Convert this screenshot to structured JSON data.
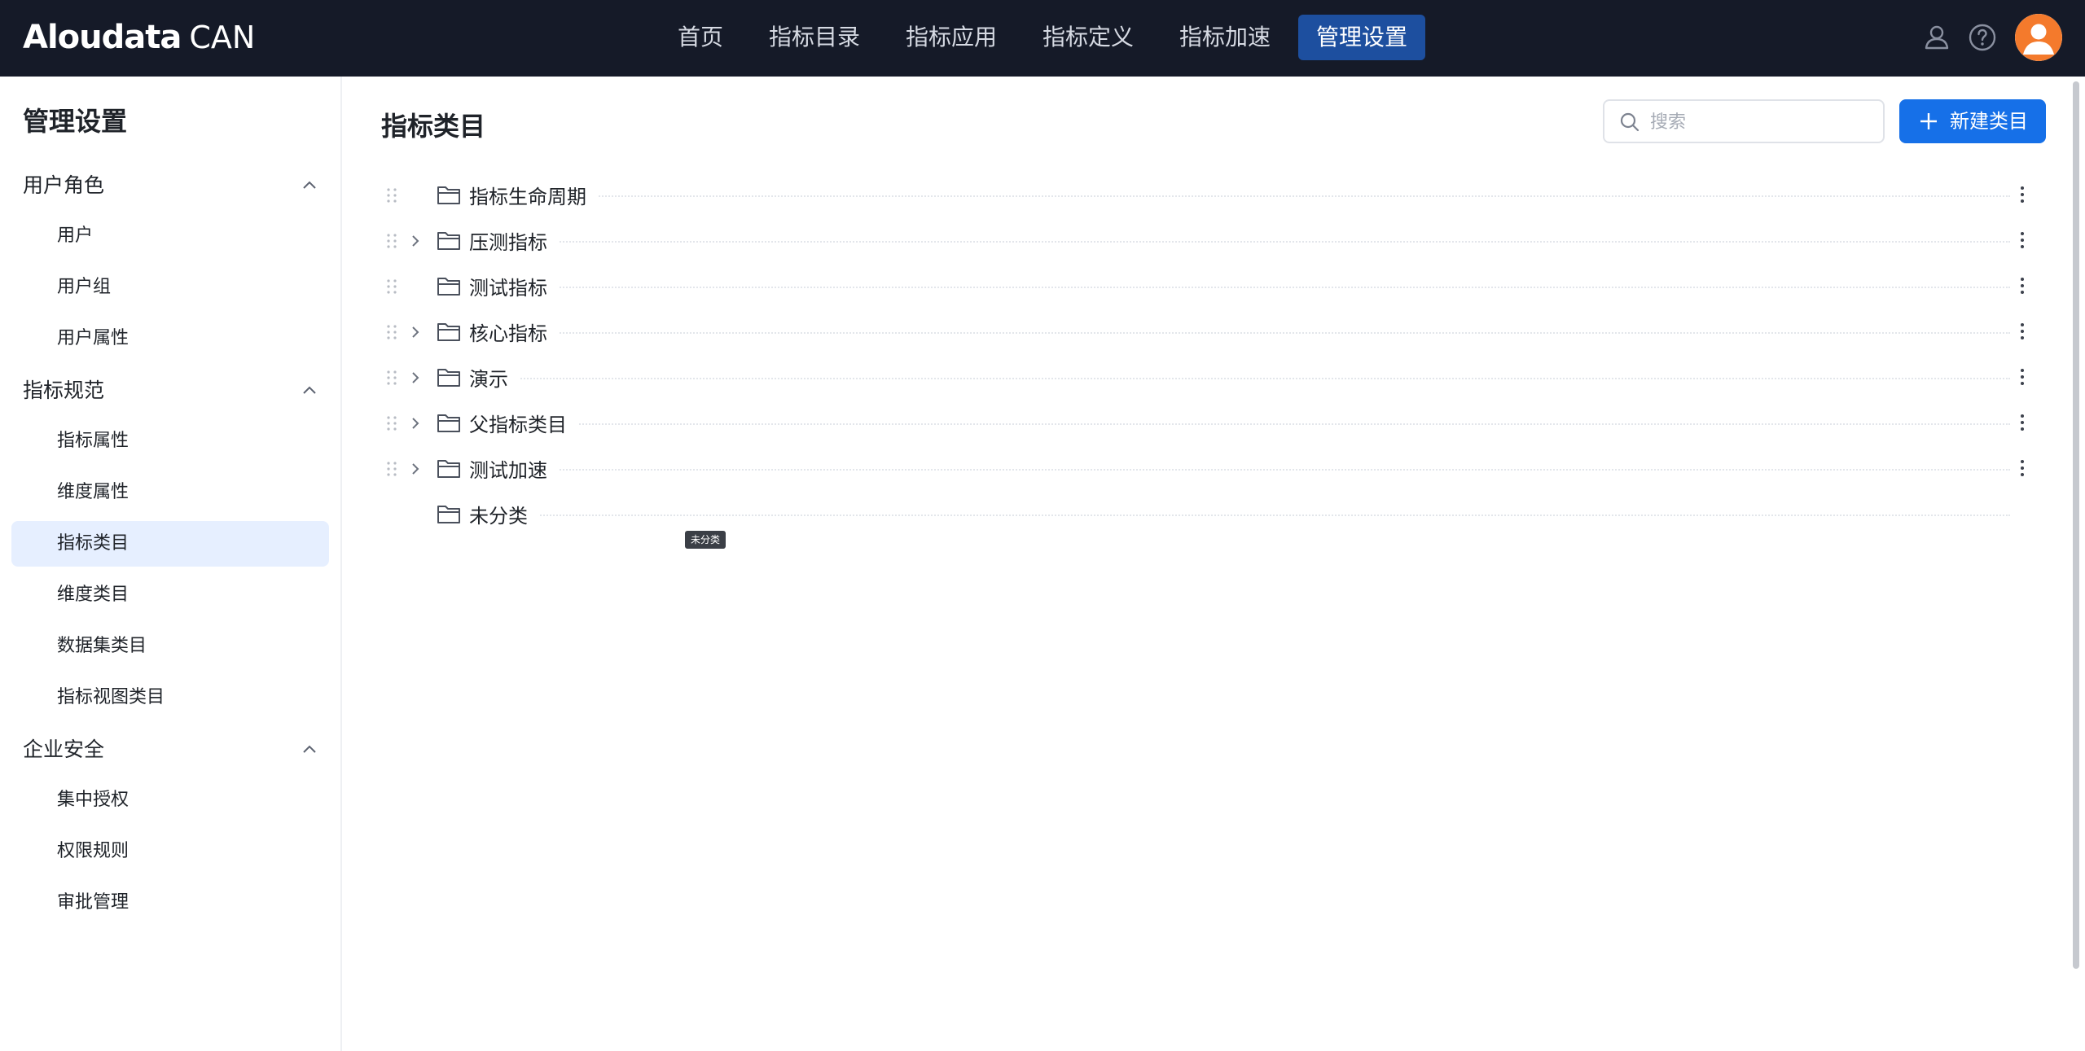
{
  "app": {
    "brand": "Aloudata",
    "product": "CAN"
  },
  "nav": {
    "items": [
      {
        "label": "首页",
        "active": false
      },
      {
        "label": "指标目录",
        "active": false
      },
      {
        "label": "指标应用",
        "active": false
      },
      {
        "label": "指标定义",
        "active": false
      },
      {
        "label": "指标加速",
        "active": false
      },
      {
        "label": "管理设置",
        "active": true
      }
    ],
    "icons": [
      "user-icon",
      "help-icon",
      "avatar"
    ]
  },
  "sidebar": {
    "title": "管理设置",
    "groups": [
      {
        "label": "用户角色",
        "expanded": true,
        "items": [
          {
            "label": "用户",
            "active": false
          },
          {
            "label": "用户组",
            "active": false
          },
          {
            "label": "用户属性",
            "active": false
          }
        ]
      },
      {
        "label": "指标规范",
        "expanded": true,
        "items": [
          {
            "label": "指标属性",
            "active": false
          },
          {
            "label": "维度属性",
            "active": false
          },
          {
            "label": "指标类目",
            "active": true
          },
          {
            "label": "维度类目",
            "active": false
          },
          {
            "label": "数据集类目",
            "active": false
          },
          {
            "label": "指标视图类目",
            "active": false
          }
        ]
      },
      {
        "label": "企业安全",
        "expanded": true,
        "items": [
          {
            "label": "集中授权",
            "active": false
          },
          {
            "label": "权限规则",
            "active": false
          },
          {
            "label": "审批管理",
            "active": false
          }
        ]
      }
    ]
  },
  "main": {
    "title": "指标类目",
    "search": {
      "placeholder": "搜索",
      "value": ""
    },
    "new_button": "新建类目",
    "tree": [
      {
        "label": "指标生命周期",
        "expandable": false,
        "draggable": true,
        "has_menu": true
      },
      {
        "label": "压测指标",
        "expandable": true,
        "draggable": true,
        "has_menu": true
      },
      {
        "label": "测试指标",
        "expandable": false,
        "draggable": true,
        "has_menu": true
      },
      {
        "label": "核心指标",
        "expandable": true,
        "draggable": true,
        "has_menu": true
      },
      {
        "label": "演示",
        "expandable": true,
        "draggable": true,
        "has_menu": true
      },
      {
        "label": "父指标类目",
        "expandable": true,
        "draggable": true,
        "has_menu": true
      },
      {
        "label": "测试加速",
        "expandable": true,
        "draggable": true,
        "has_menu": true
      },
      {
        "label": "未分类",
        "expandable": false,
        "draggable": false,
        "has_menu": false
      }
    ],
    "tooltip": "未分类"
  },
  "colors": {
    "topbar": "#151a28",
    "nav_active": "#1d4f9f",
    "primary": "#1670e8",
    "sidebar_active": "#e6efff",
    "avatar": "#f47a2c"
  }
}
